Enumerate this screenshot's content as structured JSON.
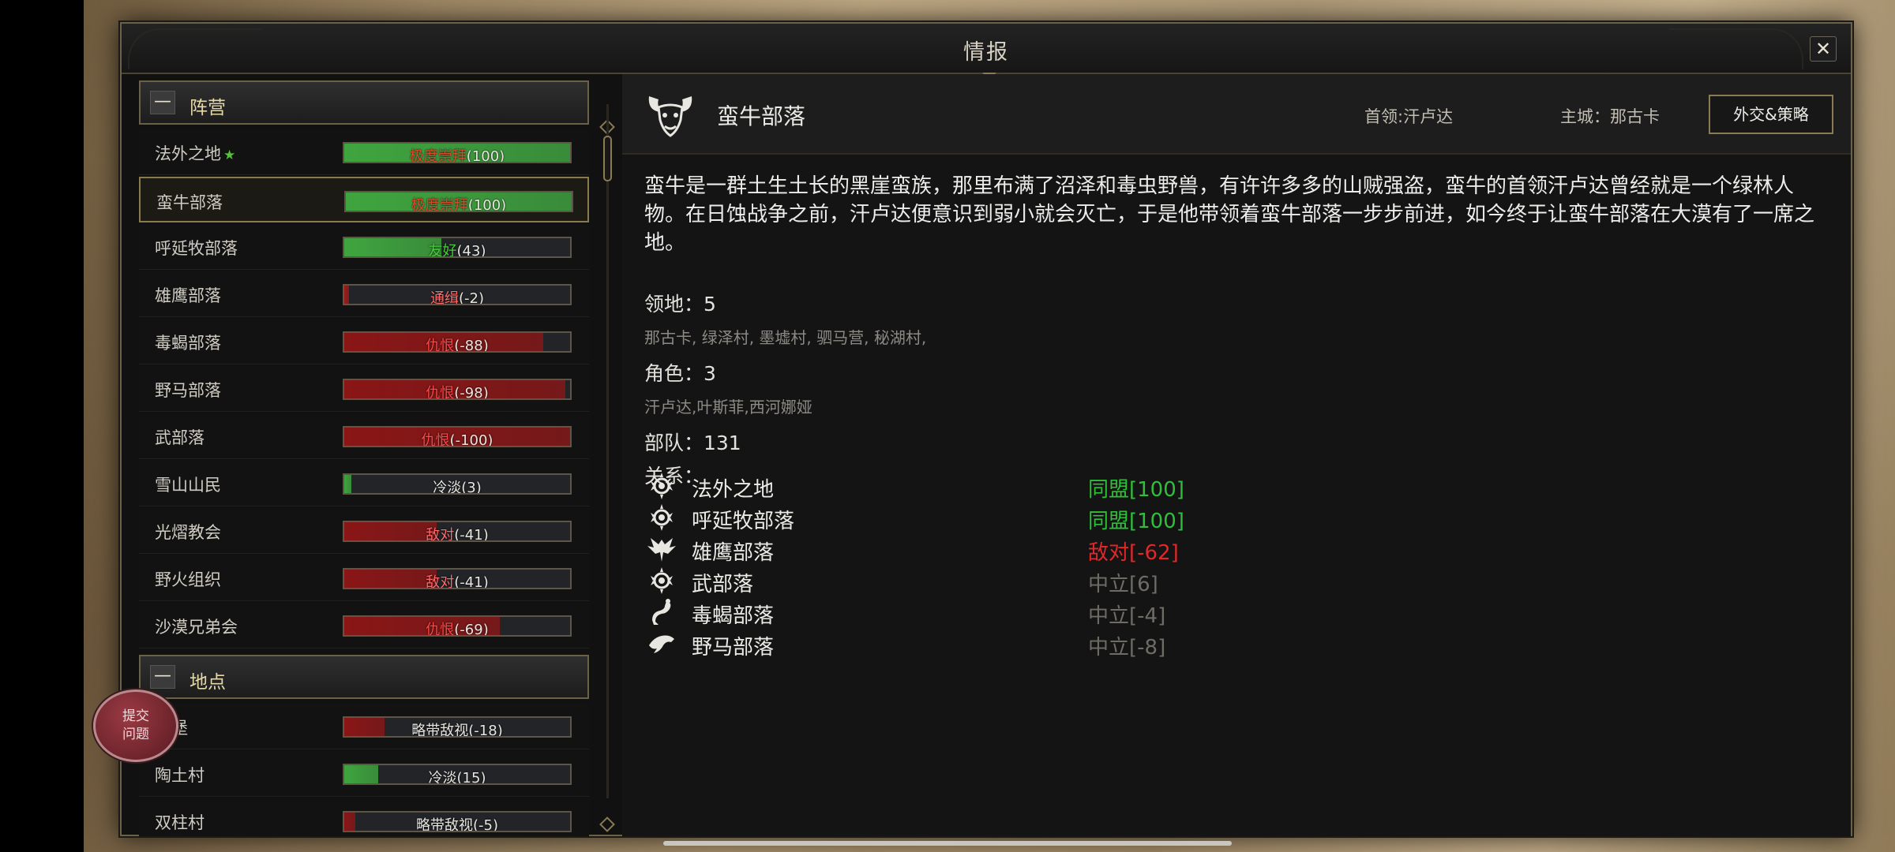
{
  "window": {
    "title": "情报",
    "close_icon": "✕"
  },
  "sections": {
    "factions": "阵营",
    "locations": "地点",
    "collapse_glyph": "—"
  },
  "factions": [
    {
      "name": "法外之地",
      "star": true,
      "status": "极度崇拜",
      "value": "(100)",
      "level": 100,
      "color": "#3fa53f",
      "label_color": "#d94a2c"
    },
    {
      "name": "蛮牛部落",
      "selected": true,
      "status": "极度崇拜",
      "value": "(100)",
      "level": 100,
      "color": "#3fa53f",
      "label_color": "#d94a2c"
    },
    {
      "name": "呼延牧部落",
      "status": "友好",
      "value": "(43)",
      "level": 43,
      "color": "#3fa53f",
      "label_color": "#48d03a"
    },
    {
      "name": "雄鹰部落",
      "status": "通缉",
      "value": "(-2)",
      "level": 2,
      "color": "#9a1a1a",
      "label_color": "#ff6a6a"
    },
    {
      "name": "毒蝎部落",
      "status": "仇恨",
      "value": "(-88)",
      "level": 88,
      "color": "#8a1616",
      "label_color": "#ff4848"
    },
    {
      "name": "野马部落",
      "status": "仇恨",
      "value": "(-98)",
      "level": 98,
      "color": "#8a1616",
      "label_color": "#ff4848"
    },
    {
      "name": "武部落",
      "status": "仇恨",
      "value": "(-100)",
      "level": 100,
      "color": "#8a1616",
      "label_color": "#ff4848"
    },
    {
      "name": "雪山山民",
      "status": "冷淡",
      "value": "(3)",
      "level": 3,
      "color": "#3fa53f",
      "label_color": "#e9e6df"
    },
    {
      "name": "光熠教会",
      "status": "敌对",
      "value": "(-41)",
      "level": 41,
      "color": "#8a1616",
      "label_color": "#ff6a6a"
    },
    {
      "name": "野火组织",
      "status": "敌对",
      "value": "(-41)",
      "level": 41,
      "color": "#8a1616",
      "label_color": "#ff6a6a"
    },
    {
      "name": "沙漠兄弟会",
      "status": "仇恨",
      "value": "(-69)",
      "level": 69,
      "color": "#8a1616",
      "label_color": "#ff4848"
    }
  ],
  "locations": [
    {
      "name": "石堡",
      "status": "略带敌视",
      "value": "(-18)",
      "level": 18,
      "color": "#8a1616",
      "label_color": "#e9e6df"
    },
    {
      "name": "陶土村",
      "status": "冷淡",
      "value": "(15)",
      "level": 15,
      "color": "#3fa53f",
      "label_color": "#e9e6df"
    },
    {
      "name": "双柱村",
      "status": "略带敌视",
      "value": "(-5)",
      "level": 5,
      "color": "#8a1616",
      "label_color": "#e9e6df"
    }
  ],
  "detail": {
    "name": "蛮牛部落",
    "icon": "bull-head-icon",
    "leader": "首领:汗卢达",
    "capital": "主城：那古卡",
    "diplomacy_button": "外交&策略",
    "description": "蛮牛是一群土生土长的黑崖蛮族，那里布满了沼泽和毒虫野兽，有许许多多的山贼强盗，蛮牛的首领汗卢达曾经就是一个绿林人物。在日蚀战争之前，汗卢达便意识到弱小就会灭亡，于是他带领着蛮牛部落一步步前进，如今终于让蛮牛部落在大漠有了一席之地。",
    "territory_label": "领地：5",
    "territory_list": "那古卡, 绿泽村, 墨墟村, 驷马营, 秘湖村,",
    "roles_label": "角色：3",
    "roles_list": "汗卢达,叶斯菲,西河娜娅",
    "troops_label": "部队：131",
    "relations_label": "关系："
  },
  "relations": [
    {
      "name": "法外之地",
      "value": "同盟[100]",
      "icon": "flame-emblem-icon",
      "color": "#2fbf3a"
    },
    {
      "name": "呼延牧部落",
      "value": "同盟[100]",
      "icon": "flame-emblem-icon",
      "color": "#2fbf3a"
    },
    {
      "name": "雄鹰部落",
      "value": "敌对[-62]",
      "icon": "eagle-icon",
      "color": "#e0282a"
    },
    {
      "name": "武部落",
      "value": "中立[6]",
      "icon": "flame-emblem-icon",
      "color": "#6f6c66"
    },
    {
      "name": "毒蝎部落",
      "value": "中立[-4]",
      "icon": "scorpion-icon",
      "color": "#6f6c66"
    },
    {
      "name": "野马部落",
      "value": "中立[-8]",
      "icon": "horse-icon",
      "color": "#6f6c66"
    }
  ],
  "floating_badge": {
    "text": "提交问题"
  }
}
